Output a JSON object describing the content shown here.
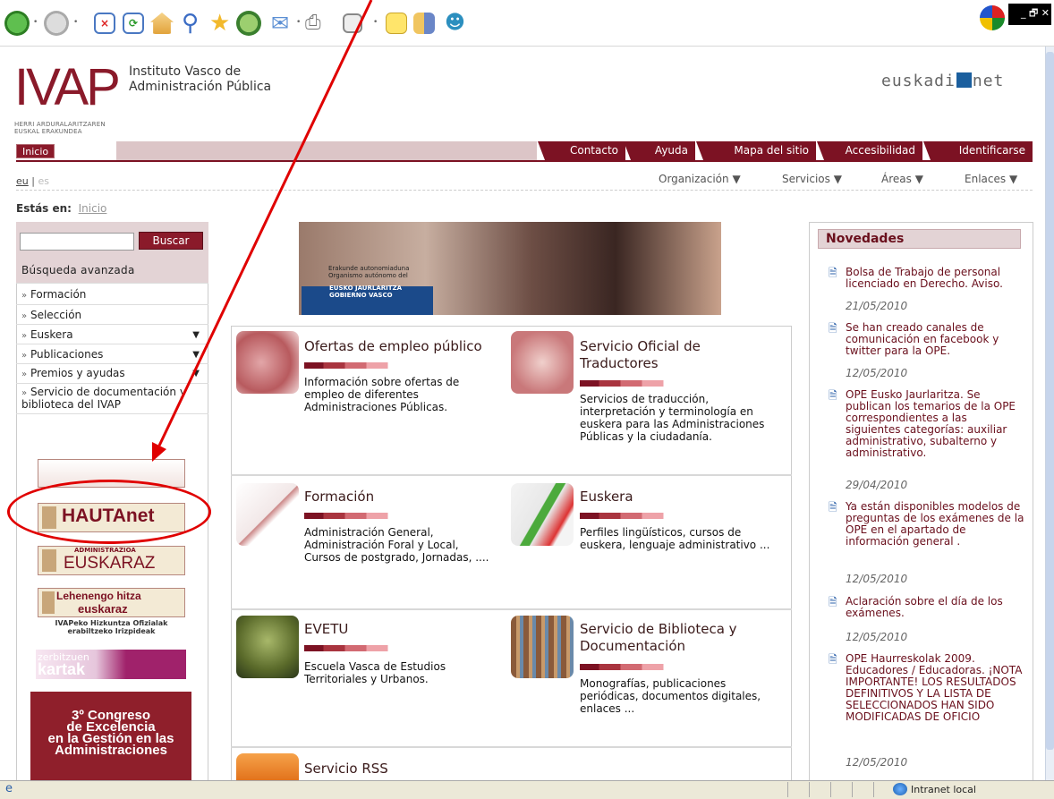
{
  "browser": {
    "toolbar_icons": [
      "back-icon",
      "forward-icon",
      "stop-icon",
      "refresh-icon",
      "home-icon",
      "search-icon",
      "favorites-icon",
      "history-icon",
      "mail-icon",
      "print-icon",
      "edit-icon",
      "notes-icon",
      "research-icon",
      "messenger-icon"
    ],
    "window_controls": {
      "minimize": "_",
      "restore": "🗗",
      "close": "✕"
    },
    "status": {
      "zone": "Intranet local"
    }
  },
  "header": {
    "logo_text": "IVAP",
    "institute_line1": "Instituto Vasco de",
    "institute_line2": "Administración Pública",
    "logo_sub_line1": "HERRI ARDURALARITZAREN",
    "logo_sub_line2": "EUSKAL ERAKUNDEA",
    "euskadi_left": "euskadi",
    "euskadi_right": "net"
  },
  "topnav": {
    "inicio": "Inicio",
    "items": [
      "Contacto",
      "Ayuda",
      "Mapa del sitio",
      "Accesibilidad",
      "Identificarse"
    ]
  },
  "lang": {
    "eu": "eu",
    "sep": "|",
    "es": "es"
  },
  "mainmenu": [
    "Organización",
    "Servicios",
    "Áreas",
    "Enlaces"
  ],
  "breadcrumb": {
    "label": "Estás en:",
    "current": "Inicio"
  },
  "search": {
    "button": "Buscar",
    "advanced": "Búsqueda avanzada"
  },
  "leftmenu": [
    {
      "label": "Formación",
      "dropdown": false
    },
    {
      "label": "Selección",
      "dropdown": false
    },
    {
      "label": "Euskera",
      "dropdown": true
    },
    {
      "label": "Publicaciones",
      "dropdown": true
    },
    {
      "label": "Premios y ayudas",
      "dropdown": true
    },
    {
      "label": "Servicio de documentación y biblioteca del IVAP",
      "dropdown": false
    }
  ],
  "banners": {
    "hautanet": "HAUTAnet",
    "euskaraz": "EUSKARAZ",
    "euskaraz_top": "ADMINISTRAZIOA",
    "lehenengo_line1": "Lehenengo hitza",
    "lehenengo_line2": "euskaraz",
    "lehenengo_sub_line1": "IVAPeko Hizkuntza Ofizialak",
    "lehenengo_sub_line2": "erabiltzeko Irizpideak",
    "zerbitzuen": "zerbitzuen",
    "kartak": "kartak",
    "congreso_line1": "3º Congreso",
    "congreso_line2": "de Excelencia",
    "congreso_line3": "en la Gestión en las",
    "congreso_line4": "Administraciones"
  },
  "hero": {
    "caption_line1": "Erakunde autonomiaduna",
    "caption_line2": "Organismo autónomo del",
    "tag_line1": "EUSKO JAURLARITZA",
    "tag_line2": "GOBIERNO VASCO"
  },
  "cards": [
    {
      "title": "Ofertas de empleo público",
      "desc": "Información sobre ofertas de empleo de diferentes Administraciones Públicas."
    },
    {
      "title": "Servicio Oficial de Traductores",
      "desc": "Servicios de traducción, interpretación y terminología en euskera para las Administraciones Públicas y la ciudadanía."
    },
    {
      "title": "Formación",
      "desc": "Administración General, Administración Foral y Local, Cursos de postgrado, Jornadas, ...."
    },
    {
      "title": "Euskera",
      "desc": "Perfiles lingüísticos, cursos de euskera, lenguaje administrativo ..."
    },
    {
      "title": "EVETU",
      "desc": "Escuela Vasca de Estudios Territoriales y Urbanos."
    },
    {
      "title": "Servicio de Biblioteca y Documentación",
      "desc": "Monografías, publicaciones periódicas, documentos digitales, enlaces ..."
    },
    {
      "title": "Servicio RSS",
      "desc": ""
    }
  ],
  "novedades": {
    "title": "Novedades",
    "items": [
      {
        "text": "Bolsa de Trabajo de personal licenciado en Derecho. Aviso.",
        "date": "21/05/2010"
      },
      {
        "text": "Se han creado canales de comunicación en facebook y twitter para la OPE.",
        "date": "12/05/2010"
      },
      {
        "text": "OPE Eusko Jaurlaritza. Se publican los temarios de la OPE correspondientes a las siguientes categorías: auxiliar administrativo, subalterno y administrativo.",
        "date": "29/04/2010"
      },
      {
        "text": "Ya están disponibles modelos de preguntas de los exámenes de la OPE en el apartado de información general .",
        "date": "12/05/2010"
      },
      {
        "text": "Aclaración sobre el día de los exámenes.",
        "date": "12/05/2010"
      },
      {
        "text": "OPE Haurreskolak 2009. Educadores / Educadoras. ¡NOTA IMPORTANTE! LOS RESULTADOS DEFINITIVOS Y LA LISTA DE SELECCIONADOS HAN SIDO MODIFICADAS DE OFICIO",
        "date": "12/05/2010"
      }
    ]
  },
  "annotation_color": "#e00000",
  "accent_color": "#7c1223"
}
